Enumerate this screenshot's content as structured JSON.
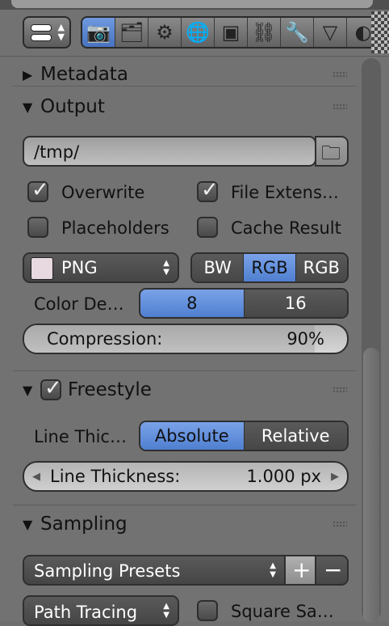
{
  "header": {
    "view_menu_icon": "view-options-icon",
    "tabs": [
      {
        "icon": "render-icon",
        "glyph": "📷",
        "active": true
      },
      {
        "icon": "render-layers-icon",
        "glyph": "🗂",
        "active": false
      },
      {
        "icon": "scene-icon",
        "glyph": "⚙",
        "active": false
      },
      {
        "icon": "world-icon",
        "glyph": "🌐",
        "active": false
      },
      {
        "icon": "object-icon",
        "glyph": "▣",
        "active": false
      },
      {
        "icon": "constraints-icon",
        "glyph": "⛓",
        "active": false
      },
      {
        "icon": "modifiers-icon",
        "glyph": "🔧",
        "active": false
      },
      {
        "icon": "data-icon",
        "glyph": "▽",
        "active": false
      },
      {
        "icon": "material-icon",
        "glyph": "◐",
        "active": false
      }
    ]
  },
  "metadata": {
    "title": "Metadata"
  },
  "output": {
    "title": "Output",
    "path": "/tmp/",
    "overwrite_label": "Overwrite",
    "overwrite_checked": true,
    "file_ext_label": "File Extens…",
    "file_ext_checked": true,
    "placeholders_label": "Placeholders",
    "placeholders_checked": false,
    "cache_label": "Cache Result",
    "cache_checked": false,
    "format": "PNG",
    "color_modes": [
      "BW",
      "RGB",
      "RGB"
    ],
    "color_mode_active": 1,
    "color_depth_label": "Color De…",
    "color_depths": [
      "8",
      "16"
    ],
    "color_depth_active": 0,
    "compression_label": "Compression:",
    "compression_value": "90%",
    "compression_fraction": 0.9
  },
  "freestyle": {
    "title": "Freestyle",
    "enabled": true,
    "line_thickness_mode_label": "Line Thic…",
    "modes": [
      "Absolute",
      "Relative"
    ],
    "mode_active": 0,
    "line_thickness_label": "Line Thickness:",
    "line_thickness_value": "1.000 px"
  },
  "sampling": {
    "title": "Sampling",
    "presets_label": "Sampling Presets",
    "add_glyph": "+",
    "remove_glyph": "−",
    "integrator": "Path Tracing",
    "square_label": "Square Sa…",
    "square_checked": false
  }
}
